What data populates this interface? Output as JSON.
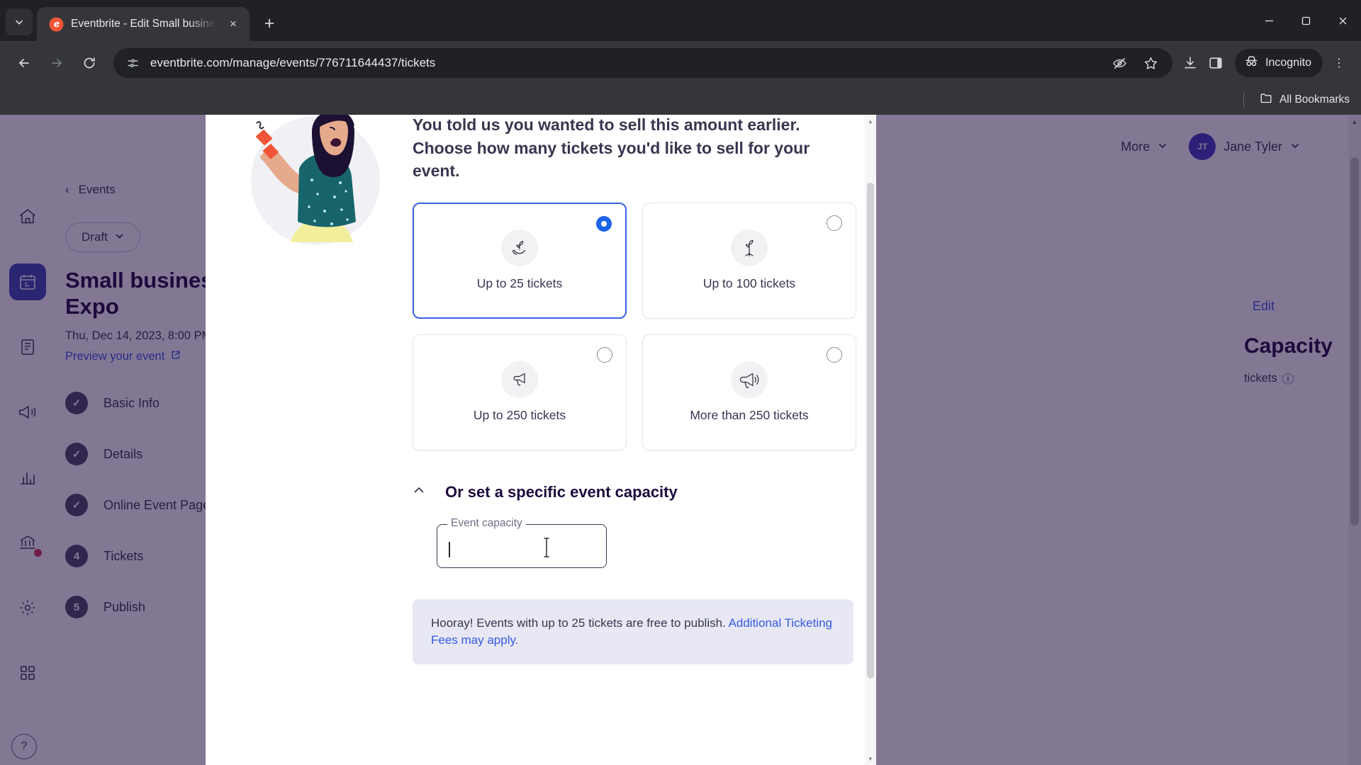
{
  "browser": {
    "tab": {
      "title": "Eventbrite - Edit Small busines",
      "close_label": "×"
    },
    "new_tab_label": "+",
    "tab_search_label": "⌄",
    "window": {
      "minimize": "—",
      "maximize": "❐",
      "close": "✕"
    },
    "nav": {
      "back": "←",
      "forward": "→",
      "reload": "⟳"
    },
    "url": "eventbrite.com/manage/events/776711644437/tickets",
    "profile_label": "Incognito",
    "bookmarks_label": "All Bookmarks",
    "menu_label": "⋮"
  },
  "app": {
    "logo": "eventbrite",
    "breadcrumb": {
      "chevron": "‹",
      "label": "Events"
    },
    "status": {
      "label": "Draft",
      "caret": "⌄"
    },
    "event_title": "Small business Expo",
    "event_date": "Thu, Dec 14, 2023, 8:00 PM",
    "preview_link": "Preview your event",
    "steps": [
      {
        "badge": "✓",
        "label": "Basic Info"
      },
      {
        "badge": "✓",
        "label": "Details"
      },
      {
        "badge": "✓",
        "label": "Online Event Page"
      },
      {
        "badge": "4",
        "label": "Tickets"
      },
      {
        "badge": "5",
        "label": "Publish"
      }
    ],
    "help_label": "?",
    "topbar": {
      "more_label": "More",
      "more_caret": "⌄",
      "user_initials": "JT",
      "user_name": "Jane Tyler",
      "user_caret": "⌄"
    },
    "background": {
      "edit_label": "Edit",
      "capacity_title": "Capacity",
      "capacity_sub": "tickets",
      "capacity_info_icon": "ⓘ"
    }
  },
  "modal": {
    "lead": "You told us you wanted to sell this amount earlier. Choose how many tickets you'd like to sell for your event.",
    "options": [
      {
        "label": "Up to 25 tickets",
        "icon": "seedling-in-hand-icon",
        "selected": true
      },
      {
        "label": "Up to 100 tickets",
        "icon": "sprout-icon",
        "selected": false
      },
      {
        "label": "Up to 250 tickets",
        "icon": "bullhorn-small-icon",
        "selected": false
      },
      {
        "label": "More than 250 tickets",
        "icon": "megaphone-icon",
        "selected": false
      }
    ],
    "capacity_section": {
      "caret": "⌃",
      "heading": "Or set a specific event capacity",
      "field_label": "Event capacity",
      "field_value": ""
    },
    "notice": {
      "text": "Hooray! Events with up to 25 tickets are free to publish. ",
      "link_text": "Additional Ticketing Fees may apply."
    }
  }
}
